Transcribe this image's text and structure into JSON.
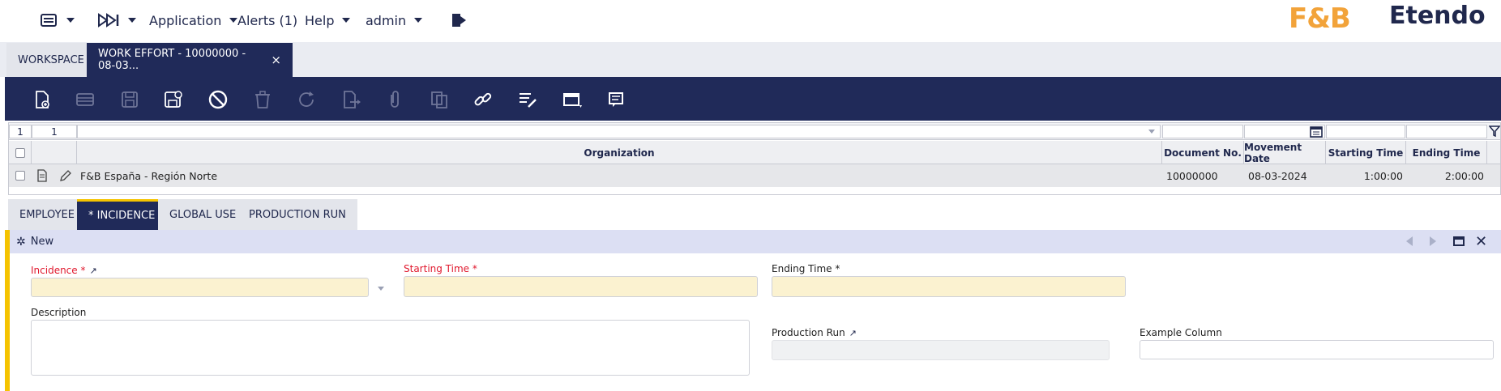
{
  "topbar": {
    "menu_icon": "list-menu-icon",
    "quicklaunch_icon": "fast-forward-icon",
    "application_label": "Application",
    "alerts_label": "Alerts (1)",
    "help_label": "Help",
    "user_label": "admin",
    "logout_icon": "logout-icon",
    "brand_fb": "F&B",
    "brand_etendo": "Etendo"
  },
  "tabs": [
    {
      "label": "WORKSPACE"
    },
    {
      "label": "WORK EFFORT - 10000000 - 08-03...",
      "close": "×"
    }
  ],
  "toolbar": {
    "icons": [
      "new-document-icon",
      "new-row-icon",
      "save-icon",
      "save-close-icon",
      "undo-icon",
      "delete-icon",
      "refresh-icon",
      "export-icon",
      "attachment-icon",
      "copy-record-icon",
      "link-icon",
      "audit-trail-icon",
      "grid-view-icon",
      "notes-icon"
    ]
  },
  "grid": {
    "filter": {
      "page": "1",
      "count": "1"
    },
    "columns": [
      "Organization",
      "Document No.",
      "Movement Date",
      "Starting Time",
      "Ending Time"
    ],
    "rows": [
      {
        "organization": "F&B España - Región Norte",
        "document_no": "10000000",
        "movement_date": "08-03-2024",
        "starting_time": "1:00:00",
        "ending_time": "2:00:00"
      }
    ]
  },
  "subtabs": [
    {
      "label": "EMPLOYEE"
    },
    {
      "label": "* INCIDENCE"
    },
    {
      "label": "GLOBAL USE"
    },
    {
      "label": "PRODUCTION RUN"
    }
  ],
  "form": {
    "status": "New",
    "fields": {
      "incidence_label": "Incidence *",
      "starting_time_label": "Starting Time *",
      "ending_time_label": "Ending Time *",
      "description_label": "Description",
      "production_run_label": "Production Run",
      "example_column_label": "Example Column"
    }
  },
  "colors": {
    "navy": "#202a59",
    "accent_yellow": "#f5c300",
    "required_red": "#e0182d",
    "brand_orange": "#f2a33a"
  }
}
